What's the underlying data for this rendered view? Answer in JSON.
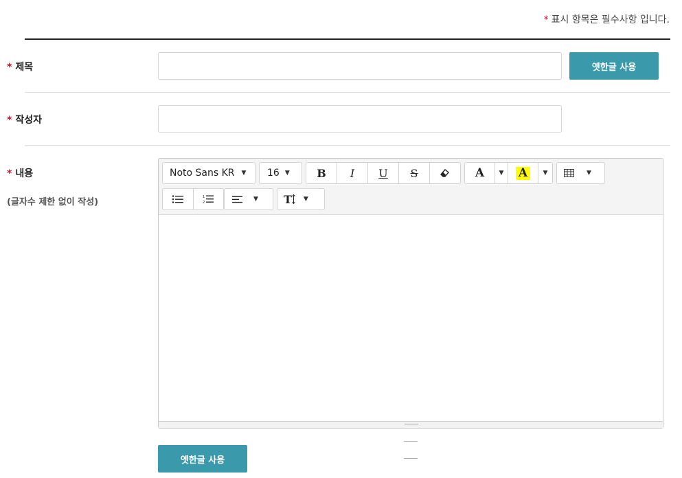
{
  "notice": {
    "star": "*",
    "text": "표시 항목은 필수사항 입니다."
  },
  "fields": {
    "title": {
      "star": "*",
      "label": "제목",
      "value": "",
      "placeholder": ""
    },
    "author": {
      "star": "*",
      "label": "작성자",
      "value": "",
      "placeholder": ""
    },
    "content": {
      "star": "*",
      "label": "내용",
      "sublabel": "(글자수 제한 없이 작성)"
    }
  },
  "buttons": {
    "old_hangul": "옛한글 사용",
    "old_hangul_bottom": "옛한글 사용"
  },
  "toolbar": {
    "font_family": "Noto Sans KR",
    "font_size": "16",
    "bold": "B",
    "italic": "I",
    "underline": "U",
    "strike": "S",
    "font_color_glyph": "A",
    "highlight_glyph": "A",
    "line_height_glyph": "T"
  },
  "colors": {
    "accent": "#3a9aab",
    "required": "#c8102e",
    "highlight": "#ffff00"
  }
}
